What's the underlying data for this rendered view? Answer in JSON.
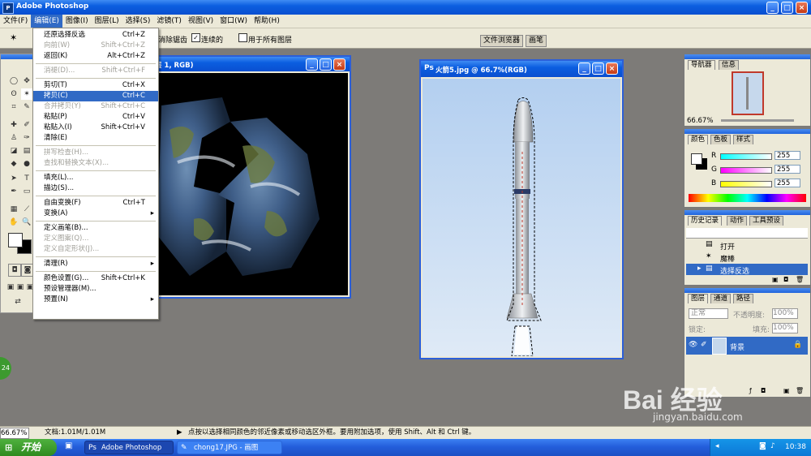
{
  "app": {
    "title": "Adobe Photoshop",
    "window_controls": {
      "minimize": "_",
      "maximize": "□",
      "close": "×"
    }
  },
  "menubar": [
    "文件(F)",
    "编辑(E)",
    "图像(I)",
    "图层(L)",
    "选择(S)",
    "滤镜(T)",
    "视图(V)",
    "窗口(W)",
    "帮助(H)"
  ],
  "options_bar": {
    "antialias_label": "消除锯齿",
    "contiguous_label": "连续的",
    "all_layers_label": "用于所有图层",
    "tabs": [
      "文件浏览器",
      "画笔"
    ]
  },
  "edit_menu": [
    {
      "label": "还原选择反选",
      "shortcut": "Ctrl+Z",
      "state": "enabled"
    },
    {
      "label": "向前(W)",
      "shortcut": "Shift+Ctrl+Z",
      "state": "disabled"
    },
    {
      "label": "返回(K)",
      "shortcut": "Alt+Ctrl+Z",
      "state": "enabled"
    },
    {
      "sep": true
    },
    {
      "label": "消褪(D)...",
      "shortcut": "Shift+Ctrl+F",
      "state": "disabled"
    },
    {
      "sep": true
    },
    {
      "label": "剪切(T)",
      "shortcut": "Ctrl+X",
      "state": "enabled"
    },
    {
      "label": "拷贝(C)",
      "shortcut": "Ctrl+C",
      "state": "highlighted"
    },
    {
      "label": "合并拷贝(Y)",
      "shortcut": "Shift+Ctrl+C",
      "state": "disabled"
    },
    {
      "label": "粘贴(P)",
      "shortcut": "Ctrl+V",
      "state": "enabled"
    },
    {
      "label": "粘贴入(I)",
      "shortcut": "Shift+Ctrl+V",
      "state": "enabled"
    },
    {
      "label": "清除(E)",
      "shortcut": "",
      "state": "enabled"
    },
    {
      "sep": true
    },
    {
      "label": "拼写检查(H)...",
      "shortcut": "",
      "state": "disabled"
    },
    {
      "label": "查找和替换文本(X)...",
      "shortcut": "",
      "state": "disabled"
    },
    {
      "sep": true
    },
    {
      "label": "填充(L)...",
      "shortcut": "",
      "state": "enabled"
    },
    {
      "label": "描边(S)...",
      "shortcut": "",
      "state": "enabled"
    },
    {
      "sep": true
    },
    {
      "label": "自由变换(F)",
      "shortcut": "Ctrl+T",
      "state": "enabled"
    },
    {
      "label": "变换(A)",
      "shortcut": "",
      "state": "enabled",
      "submenu": true
    },
    {
      "sep": true
    },
    {
      "label": "定义画笔(B)...",
      "shortcut": "",
      "state": "enabled"
    },
    {
      "label": "定义图案(Q)...",
      "shortcut": "",
      "state": "disabled"
    },
    {
      "label": "定义自定形状(J)...",
      "shortcut": "",
      "state": "disabled"
    },
    {
      "sep": true
    },
    {
      "label": "清理(R)",
      "shortcut": "",
      "state": "enabled",
      "submenu": true
    },
    {
      "sep": true
    },
    {
      "label": "颜色设置(G)...",
      "shortcut": "Shift+Ctrl+K",
      "state": "enabled"
    },
    {
      "label": "预设管理器(M)...",
      "shortcut": "",
      "state": "enabled"
    },
    {
      "label": "预置(N)",
      "shortcut": "",
      "state": "enabled",
      "submenu": true
    }
  ],
  "earth_window": {
    "title": "层 1, RGB)"
  },
  "rocket_window": {
    "title": "火箭5.jpg @ 66.7%(RGB)"
  },
  "navigator": {
    "tabs": [
      "导航器",
      "信息"
    ],
    "zoom": "66.67%"
  },
  "color_panel": {
    "tabs": [
      "颜色",
      "色板",
      "样式"
    ],
    "channels": [
      {
        "name": "R",
        "value": "255"
      },
      {
        "name": "G",
        "value": "255"
      },
      {
        "name": "B",
        "value": "255"
      }
    ]
  },
  "history_panel": {
    "tabs": [
      "历史记录",
      "动作",
      "工具预设"
    ],
    "items": [
      {
        "label": "打开"
      },
      {
        "label": "魔棒"
      },
      {
        "label": "选择反选"
      }
    ]
  },
  "layers_panel": {
    "tabs": [
      "图层",
      "通道",
      "路径"
    ],
    "blend_mode": "正常",
    "opacity_label": "不透明度:",
    "opacity": "100%",
    "lock_label": "锁定:",
    "fill_label": "填充:",
    "fill": "100%",
    "layer_name": "背景"
  },
  "status_bar": {
    "zoom": "66.67%",
    "doc": "文档:1.01M/1.01M",
    "hint": "点按以选择相同颜色的邻近像素或移动选区外框。要用附加选项，使用 Shift、Alt 和 Ctrl 键。"
  },
  "taskbar": {
    "start": "开始",
    "tasks": [
      "Adobe Photoshop",
      "chong17.JPG - 画图"
    ],
    "clock": "10:38"
  },
  "badge": {
    "value": "24"
  },
  "watermark": {
    "brand": "Bai 经验",
    "url": "jingyan.baidu.com"
  },
  "colors": {
    "accent": "#316ac5",
    "xp_blue": "#245edb",
    "start_green": "#3c9a2e"
  }
}
